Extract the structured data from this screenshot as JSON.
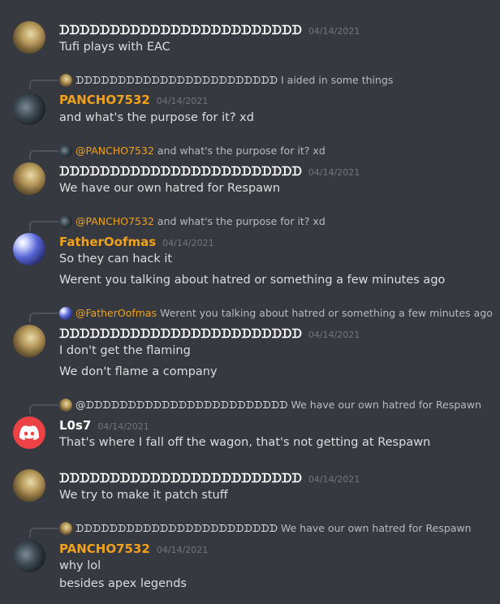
{
  "messages": [
    {
      "author": "ᗪᗪᗪᗪᗪᗪᗪᗪᗪᗪᗪᗪᗪᗪᗪᗪᗪᗪᗪᗪᗪᗪᗪᗪ",
      "timestamp": "04/14/2021",
      "lines": [
        "Tufi plays with EAC"
      ]
    },
    {
      "reply_author": "ᗪᗪᗪᗪᗪᗪᗪᗪᗪᗪᗪᗪᗪᗪᗪᗪᗪᗪᗪᗪᗪᗪᗪᗪ",
      "reply_text": "I aided in some things",
      "author": "PANCHO7532",
      "timestamp": "04/14/2021",
      "lines": [
        "and what's the purpose for it? xd"
      ]
    },
    {
      "reply_author": "@PANCHO7532",
      "reply_text": "and what's the purpose for it? xd",
      "author": "ᗪᗪᗪᗪᗪᗪᗪᗪᗪᗪᗪᗪᗪᗪᗪᗪᗪᗪᗪᗪᗪᗪᗪᗪ",
      "timestamp": "04/14/2021",
      "lines": [
        "We have our own hatred for Respawn"
      ]
    },
    {
      "reply_author": "@PANCHO7532",
      "reply_text": "and what's the purpose for it? xd",
      "author": "FatherOofmas",
      "timestamp": "04/14/2021",
      "lines": [
        "So they can hack it",
        "Werent you talking about hatred or something a few minutes ago"
      ]
    },
    {
      "reply_author": "@FatherOofmas",
      "reply_text": "Werent you talking about hatred or something a few minutes ago",
      "author": "ᗪᗪᗪᗪᗪᗪᗪᗪᗪᗪᗪᗪᗪᗪᗪᗪᗪᗪᗪᗪᗪᗪᗪᗪ",
      "timestamp": "04/14/2021",
      "lines": [
        "I don't get the flaming",
        "We don't flame a company"
      ]
    },
    {
      "reply_author": "@ᗪᗪᗪᗪᗪᗪᗪᗪᗪᗪᗪᗪᗪᗪᗪᗪᗪᗪᗪᗪᗪᗪᗪᗪ",
      "reply_text": "We have our own hatred for Respawn",
      "author": "L0s7",
      "timestamp": "04/14/2021",
      "lines": [
        "That's where I fall off the wagon, that's not getting at Respawn"
      ]
    },
    {
      "author": "ᗪᗪᗪᗪᗪᗪᗪᗪᗪᗪᗪᗪᗪᗪᗪᗪᗪᗪᗪᗪᗪᗪᗪᗪ",
      "timestamp": "04/14/2021",
      "lines": [
        "We try to make it patch stuff"
      ]
    },
    {
      "reply_author": "ᗪᗪᗪᗪᗪᗪᗪᗪᗪᗪᗪᗪᗪᗪᗪᗪᗪᗪᗪᗪᗪᗪᗪᗪ",
      "reply_text": "We have our own hatred for Respawn",
      "author": "PANCHO7532",
      "timestamp": "04/14/2021",
      "lines": [
        "why lol",
        "besides apex legends"
      ]
    }
  ],
  "colors": {
    "background": "#36393f",
    "username_default": "#ffffff",
    "username_highlight": "#f1a11a",
    "timestamp": "#72767d",
    "message_text": "#dcddde",
    "discord_red": "#ed4245"
  },
  "icons": {
    "default_avatar": "discord-logo-icon"
  }
}
